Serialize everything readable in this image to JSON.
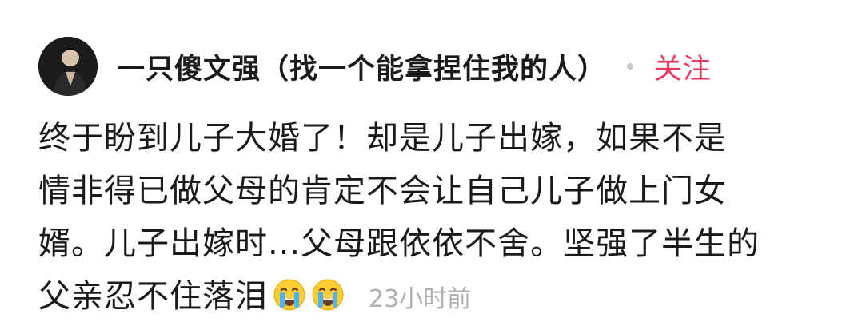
{
  "post": {
    "author": {
      "avatar_icon": "avatar-photo",
      "username": "一只傻文强（找一个能拿捏住我的人）"
    },
    "follow_label": "关注",
    "content_lines": [
      "终于盼到儿子大婚了！却是儿子出嫁，如果不是",
      "情非得已做父母的肯定不会让自己儿子做上门女",
      "婿。儿子出嫁时...父母跟依依不舍。坚强了半生的",
      "父亲忍不住落泪"
    ],
    "emojis": [
      "crying-face-icon",
      "crying-face-icon"
    ],
    "timestamp": "23小时前"
  },
  "colors": {
    "follow": "#f2355b",
    "text": "#1a1a1a",
    "timestamp": "#b0b0b0",
    "separator": "#c8c8c8"
  }
}
